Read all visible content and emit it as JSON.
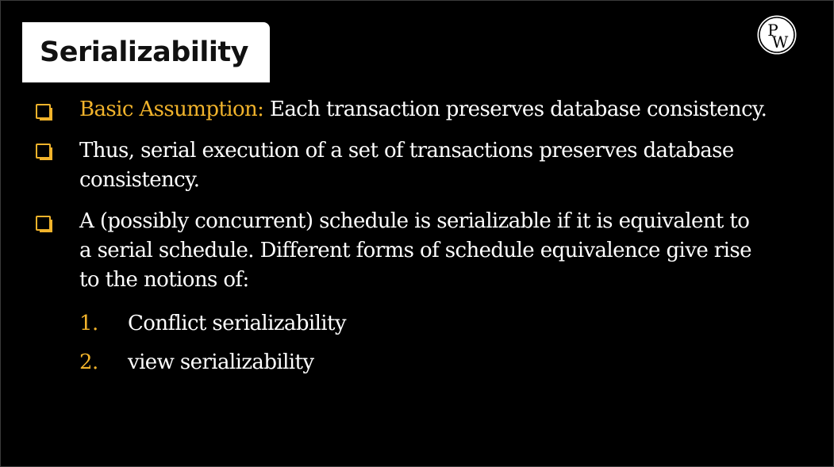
{
  "title": "Serializability",
  "logo": {
    "icon": "pw-logo-icon",
    "letters_top": "P",
    "letters_bottom": "W"
  },
  "bullets": [
    {
      "highlight": "Basic Assumption:",
      "lines": [
        "Each transaction preserves database consistency."
      ]
    },
    {
      "lines": [
        "Thus, serial execution of a set of transactions preserves database",
        "consistency."
      ]
    },
    {
      "lines": [
        "A (possibly concurrent) schedule is serializable if it is equivalent to",
        "a serial schedule. Different forms of schedule equivalence give rise",
        "to the notions of:"
      ]
    }
  ],
  "numbered": [
    {
      "num": "1.",
      "text": "Conflict serializability"
    },
    {
      "num": "2.",
      "text": "view serializability"
    }
  ],
  "colors": {
    "background": "#000000",
    "accent": "#f1b32b",
    "text": "#ffffff",
    "title_bg": "#ffffff"
  }
}
